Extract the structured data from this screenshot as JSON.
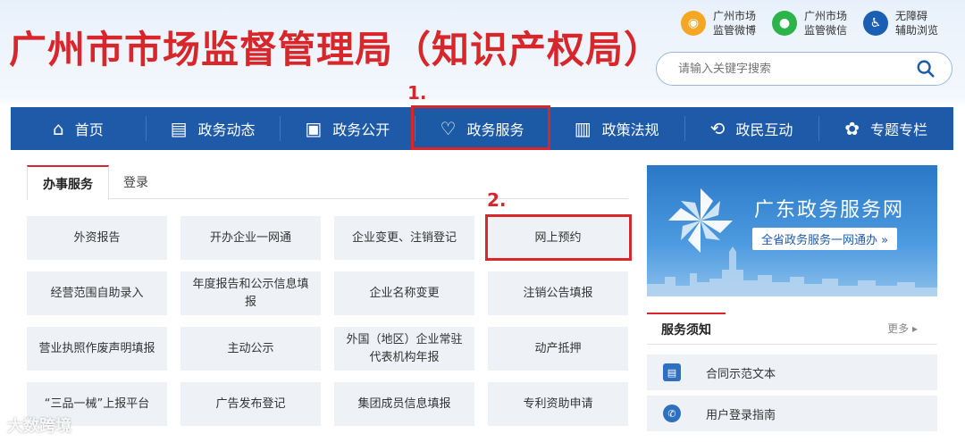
{
  "header": {
    "title": "广州市市场监督管理局（知识产权局）",
    "links": [
      {
        "label": "广州市场\n监管微博",
        "icon": "weibo-icon"
      },
      {
        "label": "广州市场\n监管微信",
        "icon": "wechat-icon"
      },
      {
        "label": "无障碍\n辅助浏览",
        "icon": "accessibility-icon"
      }
    ],
    "search_placeholder": "请输入关键字搜索"
  },
  "annotations": {
    "step1": "1.",
    "step2": "2."
  },
  "nav": {
    "items": [
      {
        "label": "首页",
        "icon": "home-icon"
      },
      {
        "label": "政务动态",
        "icon": "news-icon"
      },
      {
        "label": "政务公开",
        "icon": "open-affairs-icon"
      },
      {
        "label": "政务服务",
        "icon": "heart-icon"
      },
      {
        "label": "政策法规",
        "icon": "document-icon"
      },
      {
        "label": "政民互动",
        "icon": "interaction-icon"
      },
      {
        "label": "专题专栏",
        "icon": "topic-icon"
      }
    ]
  },
  "tabs": {
    "active": "办事服务",
    "other": "登录"
  },
  "services": [
    "外资报告",
    "开办企业一网通",
    "企业变更、注销登记",
    "网上预约",
    "经营范围自助录入",
    "年度报告和公示信息填报",
    "企业名称变更",
    "注销公告填报",
    "营业执照作废声明填报",
    "主动公示",
    "外国（地区）企业常驻代表机构年报",
    "动产抵押",
    "“三品一械”上报平台",
    "广告发布登记",
    "集团成员信息填报",
    "专利资助申请"
  ],
  "banner": {
    "title": "广东政务服务网",
    "subtitle": "全省政务服务一网通办 »"
  },
  "notice": {
    "title": "服务须知",
    "more": "更多 ▸",
    "items": [
      "合同示范文本",
      "用户登录指南"
    ]
  },
  "watermark": "大数跨境",
  "colors": {
    "brand_red": "#d8262b",
    "nav_blue": "#1e5aa8",
    "cell_bg": "#eef2f6"
  }
}
